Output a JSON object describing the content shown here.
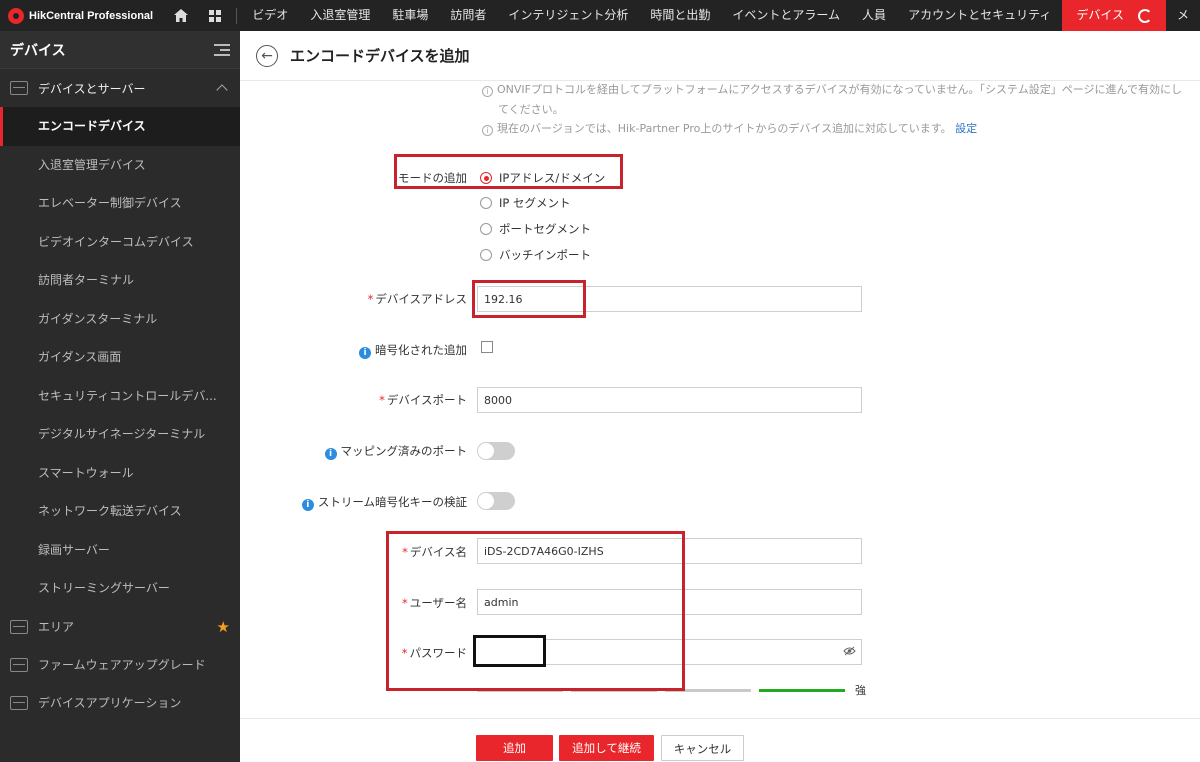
{
  "topbar": {
    "brand": "HikCentral Professional",
    "nav": [
      "ビデオ",
      "入退室管理",
      "駐車場",
      "訪問者",
      "インテリジェント分析",
      "時間と出勤",
      "イベントとアラーム",
      "人員",
      "アカウントとセキュリティ"
    ],
    "active_nav": "デバイス",
    "overflow": "メ"
  },
  "sidebar": {
    "title": "デバイス",
    "group_devices": "デバイスとサーバー",
    "items": [
      "エンコードデバイス",
      "入退室管理デバイス",
      "エレベーター制御デバイス",
      "ビデオインターコムデバイス",
      "訪問者ターミナル",
      "ガイダンスターミナル",
      "ガイダンス画面",
      "セキュリティコントロールデバ...",
      "デジタルサイネージターミナル",
      "スマートウォール",
      "ネットワーク転送デバイス",
      "録画サーバー",
      "ストリーミングサーバー"
    ],
    "group_area": "エリア",
    "group_firmware": "ファームウェアアップグレード",
    "group_apps": "デバイスアプリケーション"
  },
  "page": {
    "title": "エンコードデバイスを追加"
  },
  "info": {
    "line1": "ONVIFプロトコルを経由してプラットフォームにアクセスするデバイスが有効になっていません。「システム設定」ページに進んで有効にし",
    "line1b": "てください。",
    "line2": "現在のバージョンでは、Hik-Partner Pro上のサイトからのデバイス追加に対応しています。",
    "line2_link": "設定"
  },
  "form": {
    "mode_label": "モードの追加",
    "modes": [
      "IPアドレス/ドメイン",
      "IP セグメント",
      "ポートセグメント",
      "バッチインポート"
    ],
    "address_label": "デバイスアドレス",
    "address_value": "192.16",
    "encrypted_label": "暗号化された追加",
    "port_label": "デバイスポート",
    "port_value": "8000",
    "mapping_label": "マッピング済みのポート",
    "stream_key_label": "ストリーム暗号化キーの検証",
    "name_label": "デバイス名",
    "name_value": "iDS-2CD7A46G0-IZHS",
    "user_label": "ユーザー名",
    "user_value": "admin",
    "password_label": "パスワード",
    "strength_text": "強"
  },
  "footer": {
    "add": "追加",
    "add_continue": "追加して継続",
    "cancel": "キャンセル"
  },
  "colors": {
    "accent": "#e8262b",
    "sidebar_bg": "#2b2b2b",
    "topbar_bg": "#232323",
    "link": "#2b74c5",
    "strength": "#22aa22"
  }
}
